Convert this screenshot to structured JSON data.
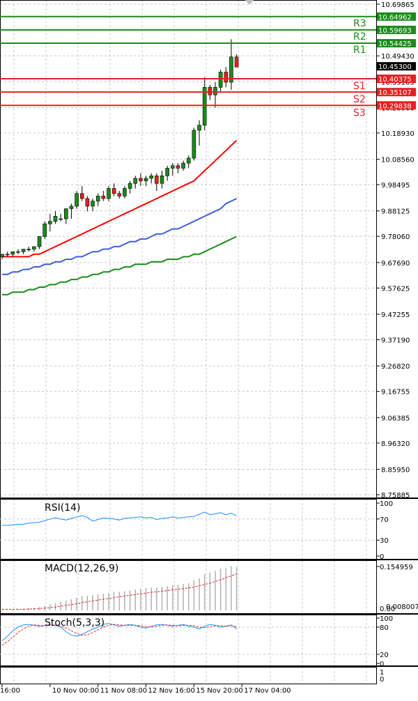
{
  "chart_data": {
    "type": "candlestick",
    "price_axis": {
      "ticks": [
        "10.69865",
        "10.59693",
        "10.49430",
        "10.39165",
        "10.28900",
        "10.18930",
        "10.08560",
        "9.98495",
        "9.88125",
        "9.78060",
        "9.67690",
        "9.57625",
        "9.47255",
        "9.37190",
        "9.26820",
        "9.16755",
        "9.06385",
        "8.96320",
        "8.85950",
        "8.75885"
      ],
      "range": [
        8.75885,
        10.69865
      ],
      "current_price": "10.45300"
    },
    "levels": [
      {
        "name": "R3",
        "value": 10.64962,
        "tag": "10.64962",
        "color": "#1a8c1a"
      },
      {
        "name": "R2",
        "value": 10.59693,
        "tag": "10.59693",
        "color": "#1a8c1a"
      },
      {
        "name": "R1",
        "value": 10.54425,
        "tag": "10.54425",
        "color": "#1a8c1a"
      },
      {
        "name": "S1",
        "value": 10.40375,
        "tag": "10.40375",
        "color": "#e82020"
      },
      {
        "name": "S2",
        "value": 10.35107,
        "tag": "10.35107",
        "color": "#e82020"
      },
      {
        "name": "S3",
        "value": 10.29838,
        "tag": "10.29838",
        "color": "#e82020"
      }
    ],
    "candles": [
      [
        9.7,
        9.71,
        9.69,
        9.71
      ],
      [
        9.71,
        9.72,
        9.7,
        9.71
      ],
      [
        9.71,
        9.72,
        9.7,
        9.72
      ],
      [
        9.72,
        9.73,
        9.71,
        9.72
      ],
      [
        9.72,
        9.73,
        9.71,
        9.73
      ],
      [
        9.73,
        9.74,
        9.72,
        9.73
      ],
      [
        9.73,
        9.74,
        9.72,
        9.74
      ],
      [
        9.74,
        9.78,
        9.73,
        9.78
      ],
      [
        9.78,
        9.84,
        9.77,
        9.83
      ],
      [
        9.83,
        9.87,
        9.8,
        9.84
      ],
      [
        9.84,
        9.88,
        9.83,
        9.86
      ],
      [
        9.85,
        9.87,
        9.84,
        9.85
      ],
      [
        9.85,
        9.89,
        9.83,
        9.89
      ],
      [
        9.89,
        9.91,
        9.85,
        9.9
      ],
      [
        9.9,
        9.96,
        9.89,
        9.95
      ],
      [
        9.95,
        9.98,
        9.92,
        9.93
      ],
      [
        9.93,
        9.94,
        9.88,
        9.9
      ],
      [
        9.9,
        9.93,
        9.88,
        9.92
      ],
      [
        9.92,
        9.95,
        9.9,
        9.94
      ],
      [
        9.94,
        9.96,
        9.92,
        9.93
      ],
      [
        9.93,
        9.98,
        9.92,
        9.97
      ],
      [
        9.97,
        9.99,
        9.94,
        9.95
      ],
      [
        9.95,
        9.96,
        9.93,
        9.94
      ],
      [
        9.94,
        9.98,
        9.93,
        9.97
      ],
      [
        9.97,
        10.0,
        9.95,
        9.99
      ],
      [
        9.99,
        10.02,
        9.97,
        10.01
      ],
      [
        10.01,
        10.03,
        9.98,
        10.0
      ],
      [
        10.0,
        10.02,
        9.98,
        10.01
      ],
      [
        10.01,
        10.03,
        9.99,
        10.02
      ],
      [
        10.02,
        10.03,
        9.96,
        9.99
      ],
      [
        9.99,
        10.04,
        9.97,
        10.02
      ],
      [
        10.02,
        10.06,
        10.0,
        10.05
      ],
      [
        10.05,
        10.07,
        10.02,
        10.06
      ],
      [
        10.06,
        10.07,
        10.03,
        10.05
      ],
      [
        10.05,
        10.08,
        10.04,
        10.07
      ],
      [
        10.07,
        10.1,
        10.05,
        10.09
      ],
      [
        10.09,
        10.21,
        10.08,
        10.2
      ],
      [
        10.2,
        10.24,
        10.14,
        10.22
      ],
      [
        10.22,
        10.41,
        10.2,
        10.37
      ],
      [
        10.37,
        10.38,
        10.32,
        10.34
      ],
      [
        10.34,
        10.39,
        10.29,
        10.37
      ],
      [
        10.37,
        10.44,
        10.35,
        10.43
      ],
      [
        10.43,
        10.45,
        10.37,
        10.39
      ],
      [
        10.39,
        10.56,
        10.36,
        10.49
      ],
      [
        10.49,
        10.5,
        10.45,
        10.45
      ]
    ],
    "moving_averages": [
      {
        "color": "#ff0000",
        "values": [
          9.7,
          9.7,
          9.7,
          9.7,
          9.7,
          9.7,
          9.71,
          9.71,
          9.72,
          9.73,
          9.74,
          9.75,
          9.76,
          9.77,
          9.78,
          9.79,
          9.8,
          9.81,
          9.82,
          9.83,
          9.84,
          9.85,
          9.86,
          9.87,
          9.88,
          9.89,
          9.9,
          9.91,
          9.92,
          9.93,
          9.94,
          9.95,
          9.96,
          9.97,
          9.98,
          9.99,
          10.0,
          10.02,
          10.04,
          10.06,
          10.08,
          10.1,
          10.12,
          10.14,
          10.16
        ]
      },
      {
        "color": "#3c5fd7",
        "values": [
          9.63,
          9.63,
          9.64,
          9.64,
          9.65,
          9.65,
          9.66,
          9.66,
          9.67,
          9.67,
          9.68,
          9.68,
          9.69,
          9.69,
          9.7,
          9.7,
          9.71,
          9.72,
          9.72,
          9.73,
          9.73,
          9.74,
          9.74,
          9.75,
          9.76,
          9.76,
          9.77,
          9.77,
          9.78,
          9.79,
          9.79,
          9.8,
          9.81,
          9.81,
          9.82,
          9.83,
          9.84,
          9.85,
          9.86,
          9.87,
          9.88,
          9.89,
          9.91,
          9.92,
          9.93
        ]
      },
      {
        "color": "#1a8c1a",
        "values": [
          9.55,
          9.55,
          9.56,
          9.56,
          9.56,
          9.57,
          9.57,
          9.58,
          9.58,
          9.59,
          9.59,
          9.6,
          9.6,
          9.61,
          9.61,
          9.62,
          9.62,
          9.63,
          9.63,
          9.64,
          9.64,
          9.65,
          9.65,
          9.66,
          9.66,
          9.67,
          9.67,
          9.67,
          9.68,
          9.68,
          9.68,
          9.69,
          9.69,
          9.69,
          9.7,
          9.7,
          9.71,
          9.71,
          9.72,
          9.73,
          9.74,
          9.75,
          9.76,
          9.77,
          9.78
        ]
      }
    ],
    "x_axis": {
      "labels": [
        "16:00",
        "10 Nov 00:00",
        "11 Nov 08:00",
        "12 Nov 16:00",
        "15 Nov 20:00",
        "17 Nov 04:00"
      ],
      "label_candle_index": [
        0,
        9,
        18,
        27,
        36,
        45
      ]
    },
    "rsi": {
      "title": "RSI(14)",
      "ticks": [
        "100",
        "70",
        "30",
        "0"
      ],
      "range": [
        0,
        100
      ],
      "values": [
        58,
        58,
        59,
        60,
        60,
        62,
        63,
        64,
        67,
        70,
        72,
        70,
        68,
        71,
        74,
        76,
        73,
        66,
        69,
        72,
        71,
        70,
        68,
        71,
        72,
        73,
        74,
        72,
        73,
        69,
        71,
        72,
        74,
        72,
        73,
        74,
        75,
        79,
        83,
        78,
        80,
        82,
        78,
        81,
        76
      ]
    },
    "macd": {
      "title": "MACD(12,26,9)",
      "ticks": [
        "0.154959",
        "0.00",
        "0.008007"
      ],
      "histogram": [
        0.002,
        0.003,
        0.004,
        0.005,
        0.006,
        0.008,
        0.009,
        0.012,
        0.016,
        0.022,
        0.027,
        0.031,
        0.035,
        0.04,
        0.046,
        0.051,
        0.053,
        0.055,
        0.058,
        0.06,
        0.063,
        0.066,
        0.067,
        0.069,
        0.072,
        0.075,
        0.078,
        0.08,
        0.082,
        0.082,
        0.084,
        0.087,
        0.09,
        0.092,
        0.095,
        0.098,
        0.108,
        0.115,
        0.13,
        0.136,
        0.142,
        0.15,
        0.152,
        0.158,
        0.156
      ],
      "signal": [
        0.004,
        0.004,
        0.004,
        0.004,
        0.004,
        0.005,
        0.006,
        0.007,
        0.008,
        0.01,
        0.012,
        0.015,
        0.018,
        0.021,
        0.024,
        0.028,
        0.031,
        0.034,
        0.037,
        0.04,
        0.043,
        0.046,
        0.049,
        0.052,
        0.054,
        0.057,
        0.06,
        0.062,
        0.065,
        0.067,
        0.069,
        0.071,
        0.074,
        0.076,
        0.078,
        0.081,
        0.084,
        0.088,
        0.093,
        0.098,
        0.104,
        0.11,
        0.117,
        0.124,
        0.131
      ],
      "range": [
        0.0,
        0.16
      ]
    },
    "stoch": {
      "title": "Stoch(5,3,3)",
      "ticks": [
        "100",
        "80",
        "20",
        "0"
      ],
      "range": [
        0,
        100
      ],
      "k": [
        50,
        60,
        72,
        80,
        85,
        86,
        84,
        82,
        83,
        85,
        84,
        80,
        70,
        62,
        60,
        64,
        70,
        76,
        80,
        86,
        88,
        85,
        82,
        84,
        86,
        84,
        80,
        78,
        82,
        85,
        86,
        84,
        82,
        84,
        86,
        82,
        80,
        76,
        82,
        86,
        84,
        80,
        82,
        85,
        76
      ],
      "d": [
        40,
        48,
        58,
        68,
        76,
        82,
        85,
        84,
        83,
        84,
        84,
        83,
        78,
        72,
        66,
        62,
        63,
        68,
        74,
        80,
        84,
        86,
        85,
        84,
        84,
        84,
        83,
        81,
        80,
        82,
        84,
        85,
        84,
        83,
        84,
        84,
        83,
        80,
        79,
        81,
        83,
        83,
        82,
        83,
        81
      ]
    },
    "bottom_panel_ticks": [
      "1",
      "0"
    ]
  }
}
